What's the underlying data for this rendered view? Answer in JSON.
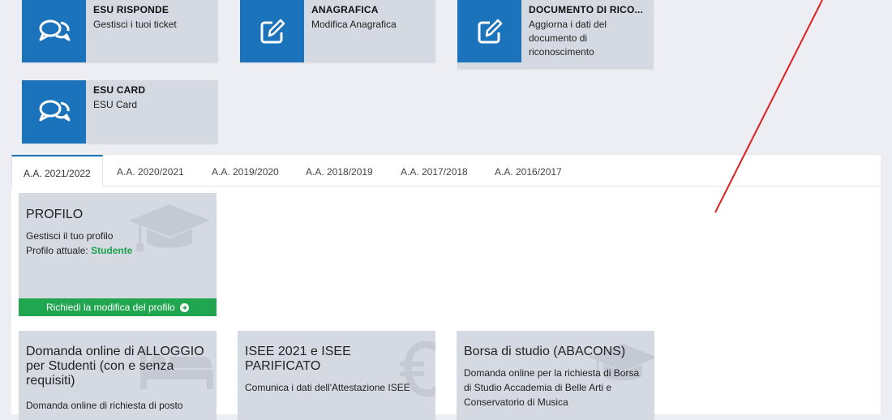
{
  "tiles": [
    {
      "title": "ESU RISPONDE",
      "desc": "Gestisci i tuoi ticket",
      "icon": "chat-bubbles-icon"
    },
    {
      "title": "ANAGRAFICA",
      "desc": "Modifica Anagrafica",
      "icon": "edit-icon"
    },
    {
      "title": "DOCUMENTO DI RICO...",
      "desc": "Aggiorna i dati del documento di riconoscimento",
      "icon": "edit-icon"
    },
    {
      "title": "ESU CARD",
      "desc": "ESU Card",
      "icon": "chat-bubbles-icon"
    }
  ],
  "tabs": [
    "A.A. 2021/2022",
    "A.A. 2020/2021",
    "A.A. 2019/2020",
    "A.A. 2018/2019",
    "A.A. 2017/2018",
    "A.A. 2016/2017"
  ],
  "profile": {
    "title": "PROFILO",
    "line1": "Gestisci il tuo profilo",
    "line2_label": "Profilo attuale:",
    "line2_value": "Studente",
    "button": "Richiedi la modifica del profilo",
    "icon": "graduation-cap-icon"
  },
  "cards": [
    {
      "title": "Domanda online di ALLOGGIO per Studenti (con e senza requisiti)",
      "desc": "Domanda online di richiesta di posto",
      "icon": "bed-icon"
    },
    {
      "title": "ISEE 2021 e ISEE PARIFICATO",
      "desc": "Comunica i dati dell'Attestazione ISEE",
      "icon": "euro-icon"
    },
    {
      "title": "Borsa di studio (ABACONS)",
      "desc": "Domanda online per la richiesta di Borsa di Studio Accademia di Belle Arti e Conservatorio di Musica",
      "icon": "graduation-cap-icon"
    }
  ],
  "colors": {
    "accent": "#1a73bb",
    "tile_bg": "#d5d9e2",
    "green": "#20a64f",
    "annotation": "#e02020"
  }
}
